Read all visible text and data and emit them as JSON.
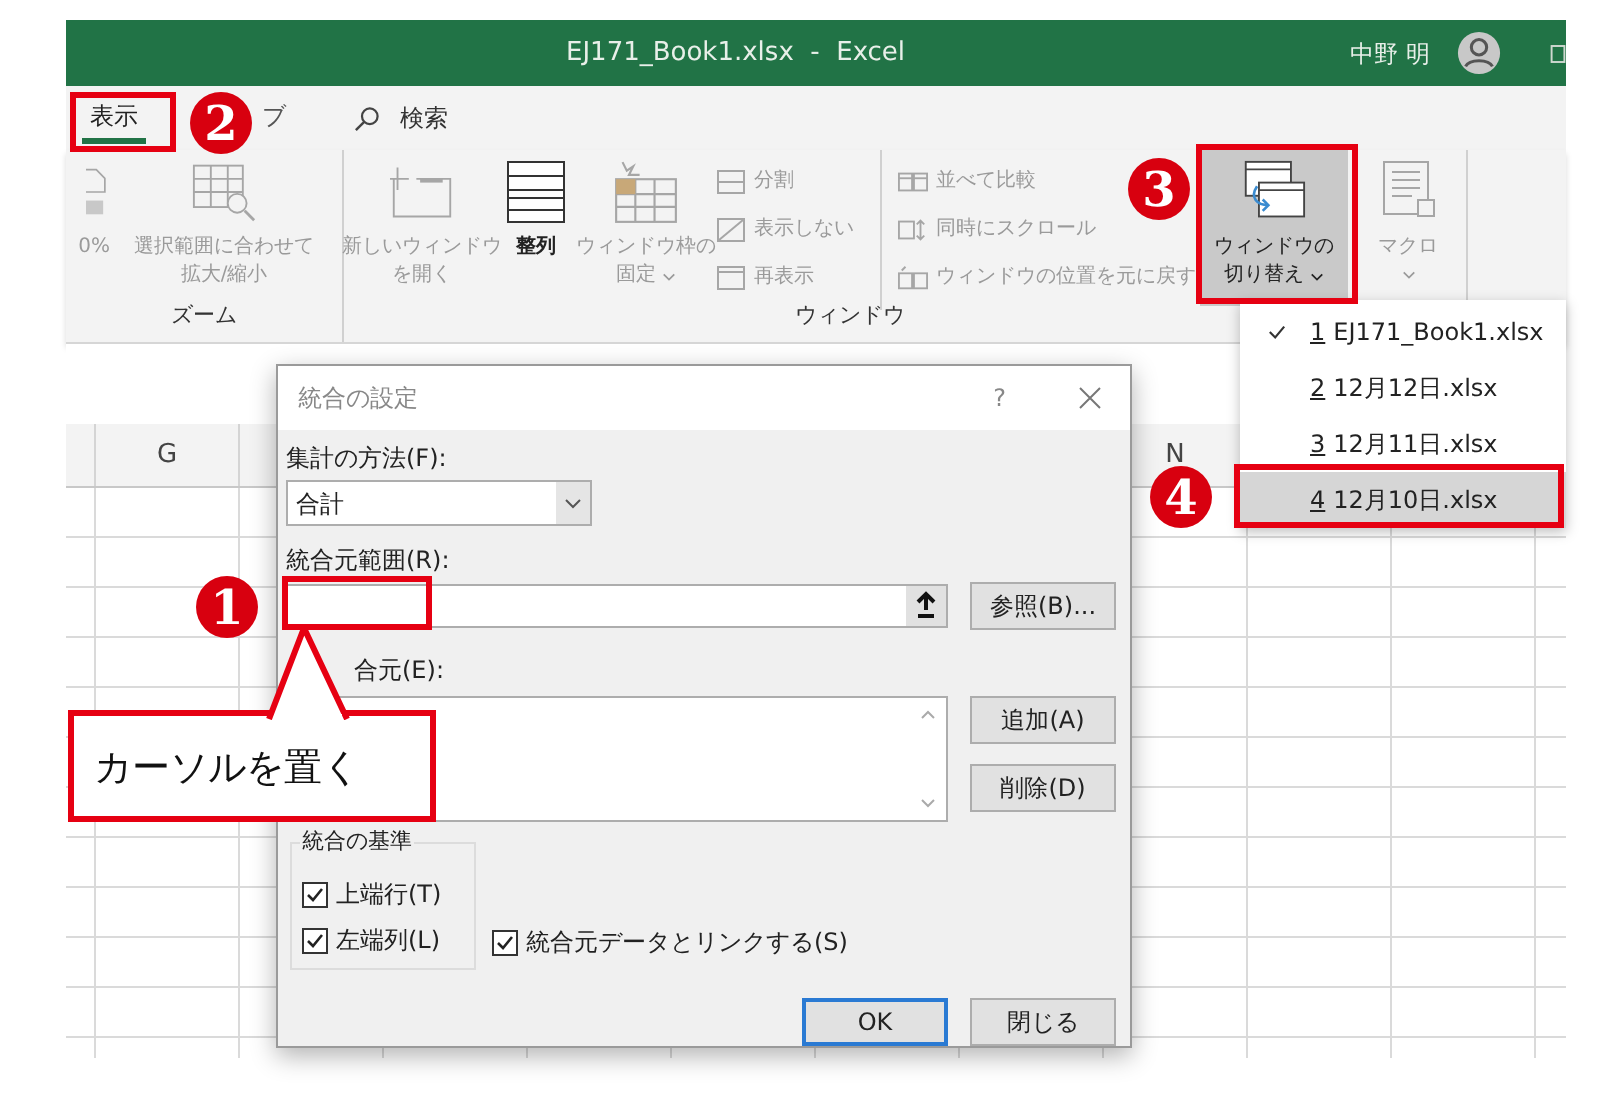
{
  "window": {
    "title": "EJ171_Book1.xlsx  -  Excel",
    "user": "中野 明"
  },
  "ribbon_tabs": [
    {
      "label": "表示",
      "selected": true
    },
    {
      "label": "ブ",
      "selected": false
    }
  ],
  "search": {
    "label": "検索"
  },
  "ribbon_groups": [
    {
      "label": "ズーム",
      "commands": [
        {
          "kind": "large",
          "lines": [
            "0%"
          ],
          "disabled": true,
          "pressed": false,
          "dropdown": false
        },
        {
          "kind": "large",
          "lines": [
            "選択範囲に合わせて",
            "拡大/縮小"
          ],
          "disabled": true,
          "pressed": false,
          "dropdown": false
        }
      ]
    },
    {
      "label": "ウィンドウ",
      "commands": [
        {
          "kind": "large",
          "lines": [
            "新しいウィンドウ",
            "を開く"
          ],
          "disabled": true,
          "pressed": false,
          "dropdown": false
        },
        {
          "kind": "large",
          "lines": [
            "整列"
          ],
          "disabled": false,
          "pressed": false,
          "dropdown": false
        },
        {
          "kind": "large",
          "lines": [
            "ウィンドウ枠の",
            "固定"
          ],
          "disabled": true,
          "pressed": false,
          "dropdown": true
        },
        {
          "kind": "small",
          "items": [
            {
              "label": "分割",
              "disabled": true
            },
            {
              "label": "表示しない",
              "disabled": true
            },
            {
              "label": "再表示",
              "disabled": true
            }
          ]
        },
        {
          "kind": "small",
          "items": [
            {
              "label": "並べて比較",
              "disabled": true
            },
            {
              "label": "同時にスクロール",
              "disabled": true
            },
            {
              "label": "ウィンドウの位置を元に戻す",
              "disabled": true
            }
          ]
        },
        {
          "kind": "large",
          "lines": [
            "ウィンドウの",
            "切り替え"
          ],
          "disabled": false,
          "pressed": true,
          "dropdown": true
        }
      ]
    },
    {
      "commands": [
        {
          "kind": "large",
          "lines": [
            "マクロ"
          ],
          "disabled": true,
          "pressed": false,
          "dropdown": true
        }
      ]
    }
  ],
  "window_menu": [
    {
      "number": "1",
      "label": "EJ171_Book1.xlsx",
      "checked": true,
      "selected": false
    },
    {
      "number": "2",
      "label": "12月12日.xlsx",
      "checked": false,
      "selected": false
    },
    {
      "number": "3",
      "label": "12月11日.xlsx",
      "checked": false,
      "selected": false
    },
    {
      "number": "4",
      "label": "12月10日.xlsx",
      "checked": false,
      "selected": true
    }
  ],
  "sheet": {
    "column_headers": [
      "G",
      "N"
    ]
  },
  "dialog": {
    "title": "統合の設定",
    "help": "?",
    "function_label": "集計の方法(F):",
    "function_value": "合計",
    "reference_label": "統合元範囲(R):",
    "browse_button": "参照(B)...",
    "all_references_label": "合元(E):",
    "add_button": "追加(A)",
    "delete_button": "削除(D)",
    "labels_group": "統合の基準",
    "checkboxes": [
      {
        "label": "上端行(T)",
        "checked": true
      },
      {
        "label": "左端列(L)",
        "checked": true
      },
      {
        "label": "統合元データとリンクする(S)",
        "checked": true
      }
    ],
    "ok_button": "OK",
    "close_button": "閉じる"
  },
  "annotations": {
    "markers": [
      "1",
      "2",
      "3",
      "4"
    ],
    "callout": "カーソルを置く"
  }
}
